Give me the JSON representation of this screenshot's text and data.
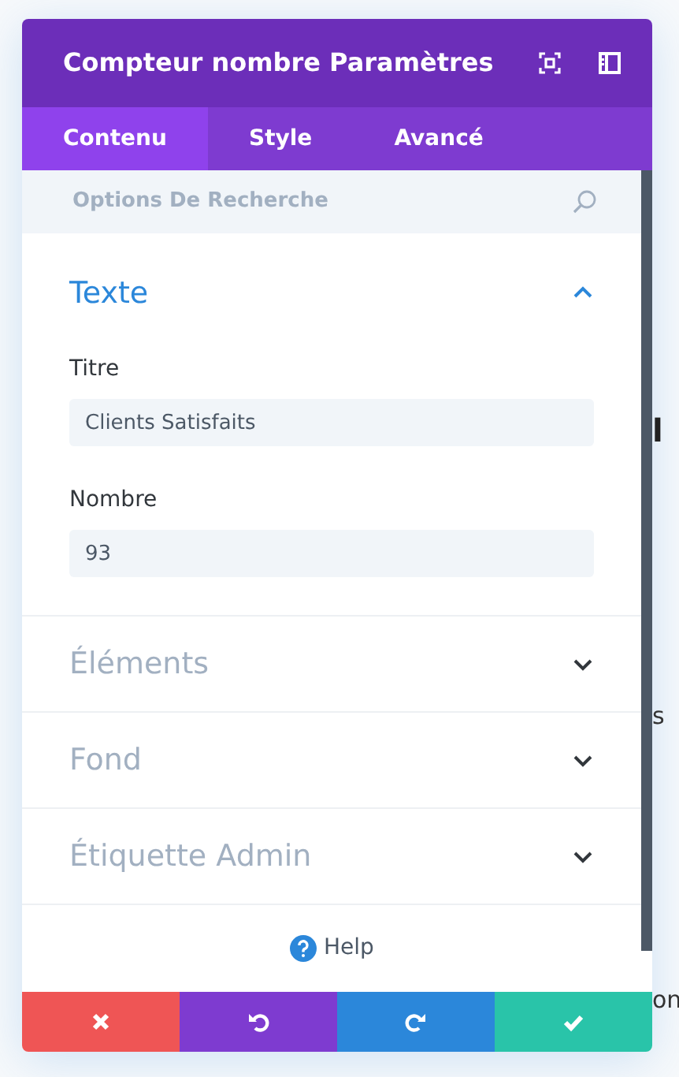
{
  "modal": {
    "title": "Compteur nombre Paramètres",
    "tabs": [
      {
        "label": "Contenu",
        "selected": true
      },
      {
        "label": "Style",
        "selected": false
      },
      {
        "label": "Avancé",
        "selected": false
      }
    ],
    "search": {
      "placeholder": "Options De Recherche"
    },
    "sections": [
      {
        "title": "Texte",
        "expanded": true,
        "fields": [
          {
            "label": "Titre",
            "value": "Clients Satisfaits"
          },
          {
            "label": "Nombre",
            "value": "93"
          }
        ]
      },
      {
        "title": "Éléments",
        "expanded": false
      },
      {
        "title": "Fond",
        "expanded": false
      },
      {
        "title": "Étiquette Admin",
        "expanded": false
      }
    ],
    "help": "Help",
    "actions": [
      {
        "kind": "cancel"
      },
      {
        "kind": "undo"
      },
      {
        "kind": "redo"
      },
      {
        "kind": "save"
      }
    ]
  },
  "background_page": {
    "texts": [
      {
        "text": "l",
        "kind": "heading"
      },
      {
        "text": "s",
        "kind": "body"
      },
      {
        "text": "on",
        "kind": "body"
      }
    ]
  }
}
